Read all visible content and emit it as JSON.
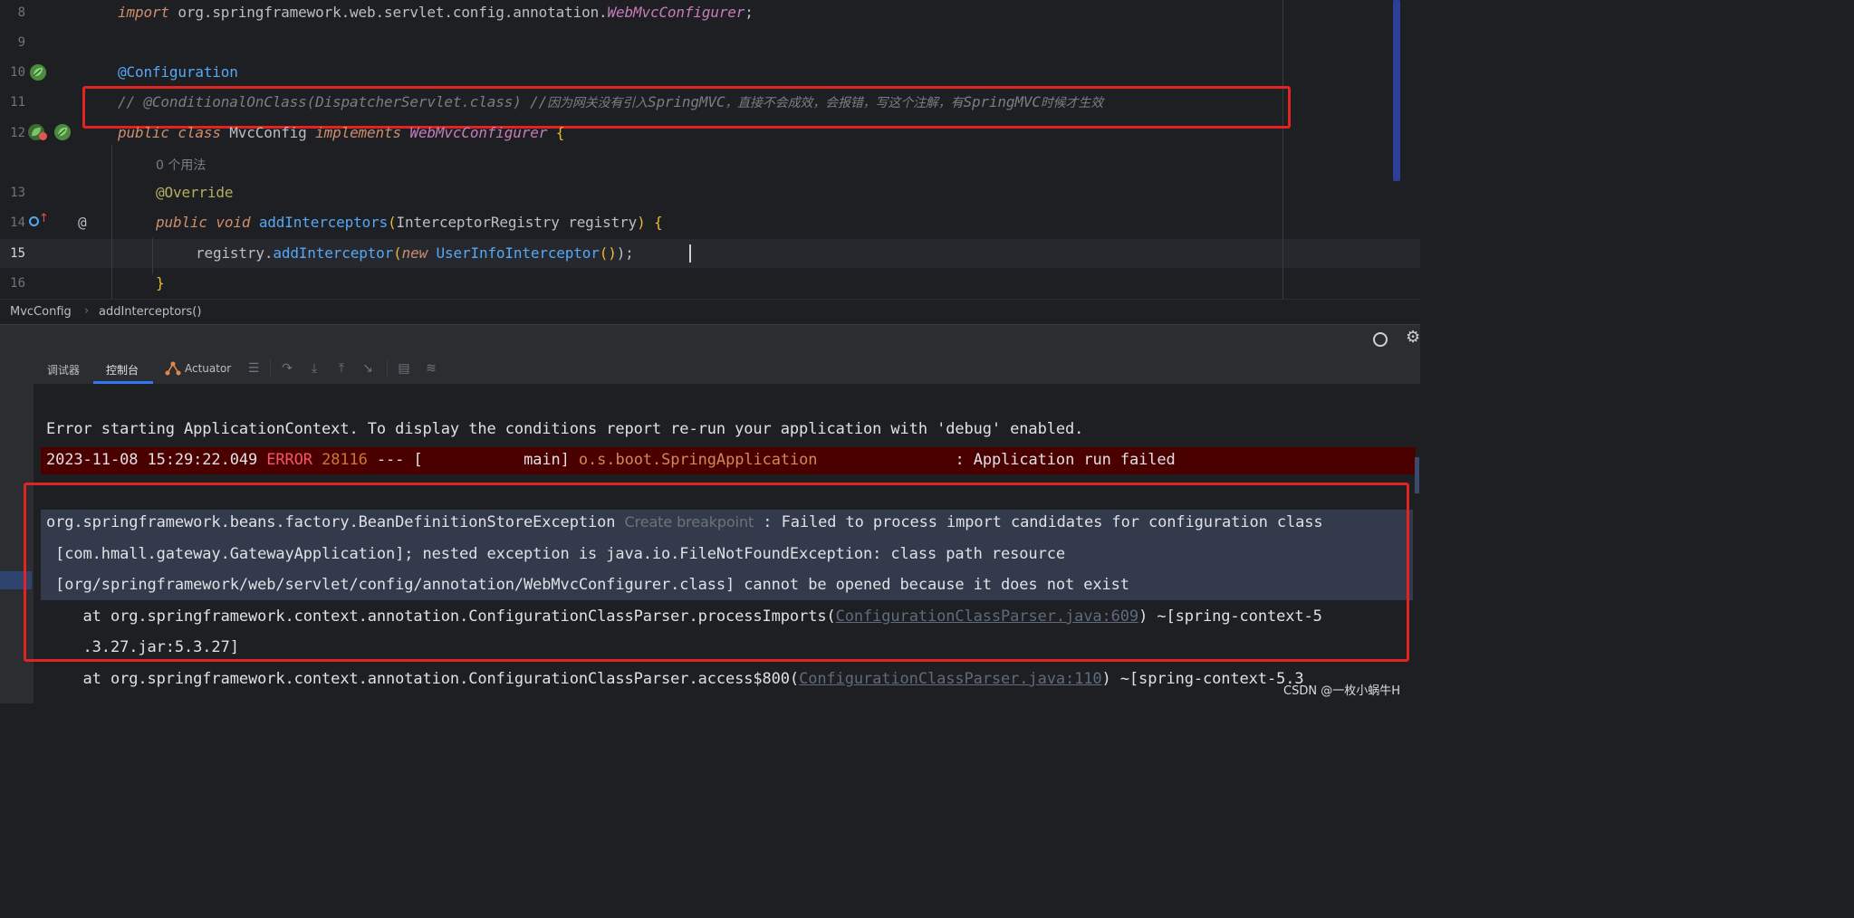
{
  "editor": {
    "lines": [
      {
        "n": "8",
        "import_kw": "import",
        "import_pkg": "org.springframework.web.servlet.config.annotation.",
        "import_cls": "WebMvcConfigurer",
        "semi": ";"
      },
      {
        "n": "9"
      },
      {
        "n": "10",
        "annotation": "@Configuration"
      },
      {
        "n": "11",
        "comment": "// @ConditionalOnClass(DispatcherServlet.class) //",
        "comment_cn_a": "因为网关没有引入",
        "comment_b": "SpringMVC",
        "comment_cn_c": "，直接不会成效，会报错，写这个注解，有",
        "comment_d": "SpringMVC",
        "comment_cn_e": "时候才生效"
      },
      {
        "n": "12",
        "kw_public": "public",
        "kw_class": "class",
        "class_name": "MvcConfig",
        "kw_impl": "implements",
        "iface": "WebMvcConfigurer",
        "brace": "{"
      },
      {
        "n": "",
        "usages": "0 个用法"
      },
      {
        "n": "13",
        "override": "@Override"
      },
      {
        "n": "14",
        "kw_public": "public",
        "kw_void": "void",
        "method": "addInterceptors",
        "paren_open": "(",
        "param_type": "InterceptorRegistry",
        "param_name": " registry",
        "paren_close": ")",
        "brace": "{"
      },
      {
        "n": "15",
        "receiver": "registry.",
        "call": "addInterceptor",
        "paren_open": "(",
        "kw_new": "new",
        "ctor": "UserInfoInterceptor",
        "args": "()",
        "end": ");"
      },
      {
        "n": "16",
        "close": "}"
      }
    ],
    "at_marker": "@"
  },
  "breadcrumb": {
    "class": "MvcConfig",
    "sep": "›",
    "method": "addInterceptors()"
  },
  "toolwindow": {
    "tabs": [
      "调试器",
      "控制台",
      "Actuator"
    ],
    "active_tab": "控制台"
  },
  "console": {
    "line1": "Error starting ApplicationContext. To display the conditions report re-run your application with 'debug' enabled.",
    "log": {
      "timestamp": "2023-11-08 15:29:22.049",
      "level": "ERROR",
      "pid": "28116",
      "sep": "--- [",
      "thread": "           main]",
      "logger": "o.s.boot.SpringApplication",
      "message": "               : Application run failed"
    },
    "exception": {
      "class": "org.springframework.beans.factory.BeanDefinitionStoreException",
      "create_bp": "Create breakpoint",
      "msg1": " : Failed to process import candidates for configuration class",
      "msg2": " [com.hmall.gateway.GatewayApplication]; nested exception is java.io.FileNotFoundException: class path resource",
      "msg3": " [org/springframework/web/servlet/config/annotation/WebMvcConfigurer.class] cannot be opened because it does not exist"
    },
    "frames": [
      {
        "prefix": "    at org.springframework.context.annotation.ConfigurationClassParser.processImports(",
        "link": "ConfigurationClassParser.java:609",
        "suffix": ") ~[spring-context-5",
        "cont": "    .3.27.jar:5.3.27]"
      },
      {
        "prefix": "    at org.springframework.context.annotation.ConfigurationClassParser.access$800(",
        "link": "ConfigurationClassParser.java:110",
        "suffix": ") ~[spring-context-5.3"
      }
    ]
  },
  "watermark": "CSDN @一枚小蜗牛H",
  "colors": {
    "error": "#f75464",
    "highlight_box": "#e32222",
    "error_row_bg": "#4b0000"
  }
}
